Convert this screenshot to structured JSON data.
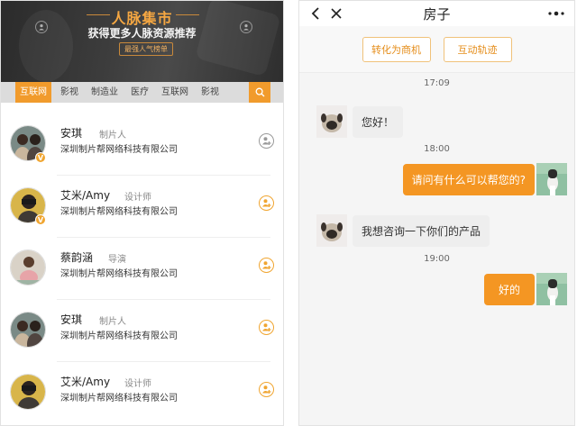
{
  "left": {
    "banner": {
      "title": "人脉集市",
      "subtitle": "获得更多人脉资源推荐",
      "tag": "最强人气榜单"
    },
    "categories": [
      {
        "label": "互联网",
        "active": true
      },
      {
        "label": "影视",
        "active": false
      },
      {
        "label": "制造业",
        "active": false
      },
      {
        "label": "医疗",
        "active": false
      },
      {
        "label": "互联网",
        "active": false
      },
      {
        "label": "影视",
        "active": false
      }
    ],
    "search_icon": "search-icon",
    "people": [
      {
        "name": "安琪",
        "role": "制片人",
        "company": "深圳制片帮网络科技有限公司",
        "badge": "V",
        "action_icon": "user-add-icon",
        "action_color": "#999999"
      },
      {
        "name": "艾米/Amy",
        "role": "设计师",
        "company": "深圳制片帮网络科技有限公司",
        "badge": "V",
        "action_icon": "user-add-icon",
        "action_color": "#f0a530"
      },
      {
        "name": "蔡韵涵",
        "role": "导演",
        "company": "深圳制片帮网络科技有限公司",
        "badge": "",
        "action_icon": "user-add-icon",
        "action_color": "#f0a530"
      },
      {
        "name": "安琪",
        "role": "制片人",
        "company": "深圳制片帮网络科技有限公司",
        "badge": "",
        "action_icon": "user-add-icon",
        "action_color": "#f0a530"
      },
      {
        "name": "艾米/Amy",
        "role": "设计师",
        "company": "深圳制片帮网络科技有限公司",
        "badge": "",
        "action_icon": "user-add-icon",
        "action_color": "#f0a530"
      }
    ]
  },
  "right": {
    "title": "房子",
    "back_icon": "chevron-left-icon",
    "close_icon": "close-icon",
    "more_icon": "more-icon",
    "actions": [
      "转化为商机",
      "互动轨迹"
    ],
    "messages": [
      {
        "type": "time",
        "text": "17:09"
      },
      {
        "type": "in",
        "text": "您好！"
      },
      {
        "type": "time",
        "text": "18:00"
      },
      {
        "type": "out",
        "text": "请问有什么可以帮您的?"
      },
      {
        "type": "in",
        "text": "我想咨询一下你们的产品"
      },
      {
        "type": "time",
        "text": "19:00"
      },
      {
        "type": "out",
        "text": "好的"
      }
    ],
    "colors": {
      "accent": "#f49623",
      "incoming_bubble": "#eeeeee"
    }
  }
}
